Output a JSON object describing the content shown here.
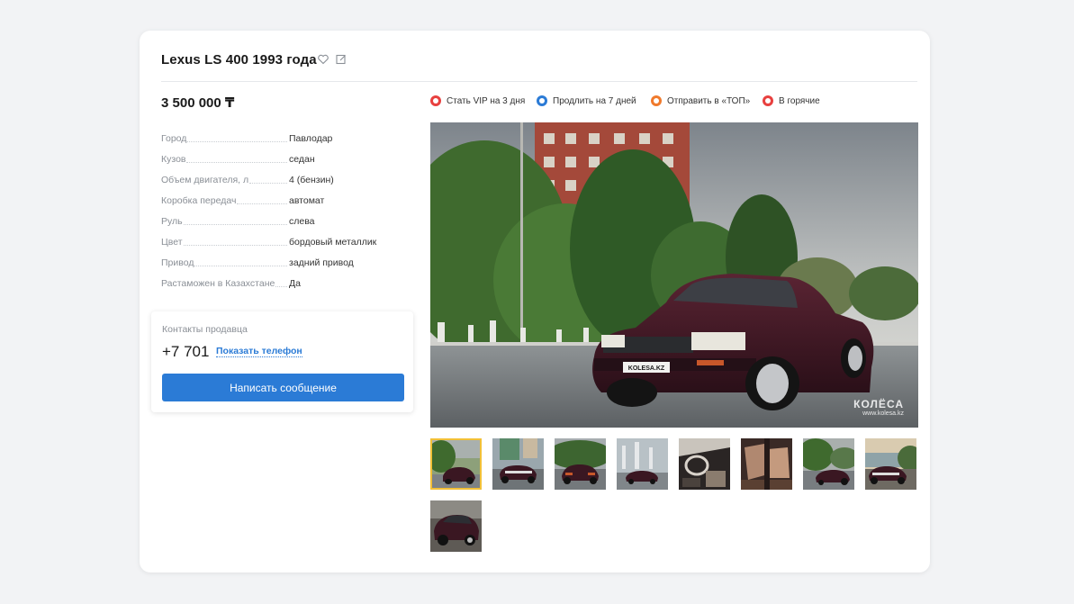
{
  "listing": {
    "title": "Lexus LS 400 1993 года",
    "price": "3 500 000 ₸"
  },
  "specs": [
    {
      "label": "Город",
      "value": "Павлодар"
    },
    {
      "label": "Кузов",
      "value": "седан"
    },
    {
      "label": "Объем двигателя, л",
      "value": "4 (бензин)"
    },
    {
      "label": "Коробка передач",
      "value": "автомат"
    },
    {
      "label": "Руль",
      "value": "слева"
    },
    {
      "label": "Цвет",
      "value": "бордовый металлик"
    },
    {
      "label": "Привод",
      "value": "задний привод"
    },
    {
      "label": "Растаможен в Казахстане",
      "value": "Да"
    }
  ],
  "contacts": {
    "title": "Контакты продавца",
    "phone": "+7 701",
    "show_phone": "Показать телефон",
    "message_button": "Написать сообщение"
  },
  "promos": [
    {
      "label": "Стать VIP на 3 дня",
      "icon": "vip-icon",
      "color": "#e8403f"
    },
    {
      "label": "Продлить на 7 дней",
      "icon": "renew-icon",
      "color": "#2b7bd6"
    },
    {
      "label": "Отправить в «ТОП»",
      "icon": "top-icon",
      "color": "#f07a2c"
    },
    {
      "label": "В горячие",
      "icon": "hot-icon",
      "color": "#e8403f"
    }
  ],
  "photo": {
    "plate": "KOLESA.KZ",
    "watermark_logo": "КОЛЁСА",
    "watermark_url": "www.kolesa.kz"
  },
  "thumbnails_count": 9,
  "colors": {
    "accent": "#2b7bd6",
    "active_thumb": "#f2c037",
    "car": "#3a1722"
  }
}
